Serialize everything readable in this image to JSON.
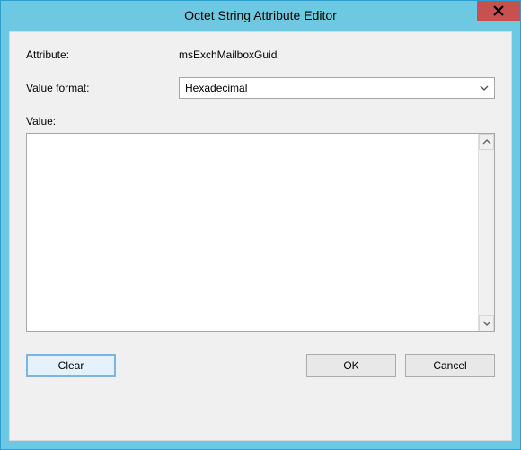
{
  "window": {
    "title": "Octet String Attribute Editor"
  },
  "labels": {
    "attribute": "Attribute:",
    "value_format": "Value format:",
    "value": "Value:"
  },
  "attribute": {
    "name": "msExchMailboxGuid"
  },
  "value_format": {
    "selected": "Hexadecimal"
  },
  "value": {
    "text": ""
  },
  "buttons": {
    "clear": "Clear",
    "ok": "OK",
    "cancel": "Cancel"
  }
}
